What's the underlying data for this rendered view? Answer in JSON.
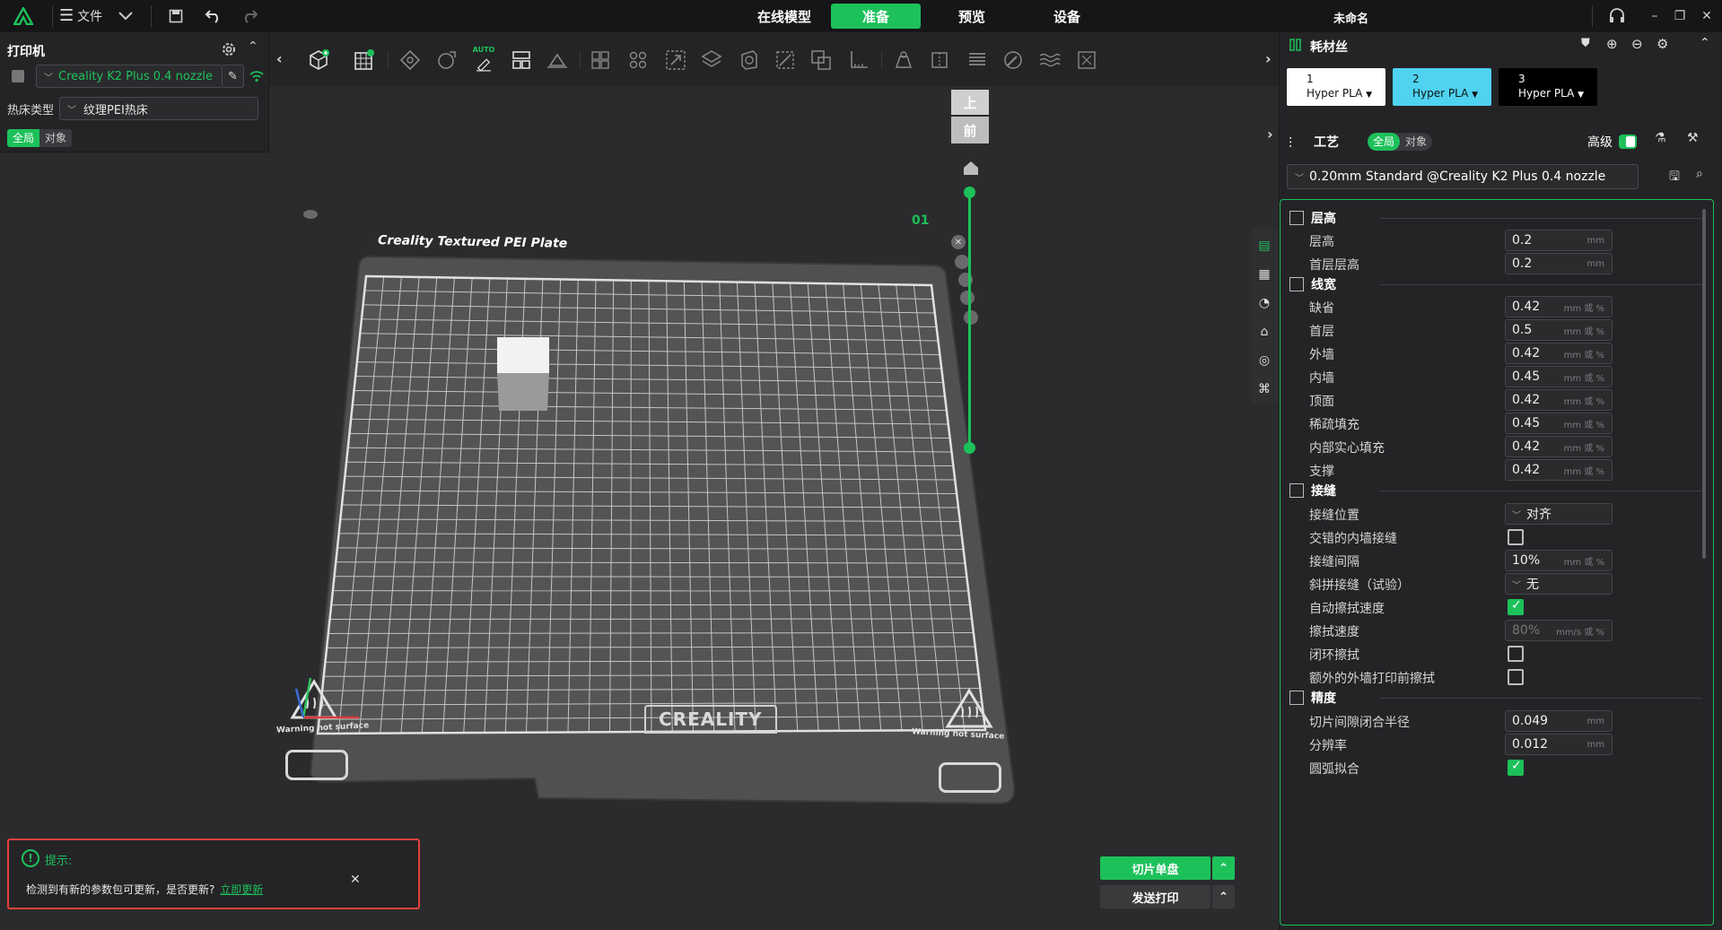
{
  "app": {
    "title": "未命名",
    "menu_file": "文件"
  },
  "tabs": [
    {
      "label": "在线模型",
      "active": false
    },
    {
      "label": "准备",
      "active": true
    },
    {
      "label": "预览",
      "active": false
    },
    {
      "label": "设备",
      "active": false
    }
  ],
  "left": {
    "printer_title": "打印机",
    "printer_name": "Creality K2 Plus 0.4 nozzle",
    "bed_label": "热床类型",
    "bed_value": "纹理PEI热床",
    "scope_global": "全局",
    "scope_object": "对象"
  },
  "plate": {
    "name": "Creality Textured PEI Plate",
    "index": "01",
    "brand": "CREALITY",
    "warning": "Warning hot surface"
  },
  "viewcube": {
    "top": "上",
    "front": "前"
  },
  "filament": {
    "title": "耗材丝",
    "slots": [
      {
        "num": "1",
        "name": "Hyper PLA",
        "color": "#ffffff",
        "text": "#111111"
      },
      {
        "num": "2",
        "name": "Hyper PLA",
        "color": "#4fd3f0",
        "text": "#111111"
      },
      {
        "num": "3",
        "name": "Hyper PLA",
        "color": "#000000",
        "text": "#ffffff"
      }
    ]
  },
  "process": {
    "title": "工艺",
    "scope_global": "全局",
    "scope_object": "对象",
    "advanced": "高级",
    "advanced_on": true,
    "preset": "0.20mm Standard @Creality K2 Plus 0.4 nozzle"
  },
  "sections": {
    "layer_height": "层高",
    "line_width": "线宽",
    "seam": "接缝",
    "precision": "精度"
  },
  "settings": {
    "layer_height": {
      "label": "层高",
      "value": "0.2",
      "unit": "mm"
    },
    "first_layer_height": {
      "label": "首层层高",
      "value": "0.2",
      "unit": "mm"
    },
    "default_width": {
      "label": "缺省",
      "value": "0.42",
      "unit": "mm 或 %"
    },
    "first_layer_width": {
      "label": "首层",
      "value": "0.5",
      "unit": "mm 或 %"
    },
    "outer_wall": {
      "label": "外墙",
      "value": "0.42",
      "unit": "mm 或 %"
    },
    "inner_wall": {
      "label": "内墙",
      "value": "0.45",
      "unit": "mm 或 %"
    },
    "top_surface": {
      "label": "顶面",
      "value": "0.42",
      "unit": "mm 或 %"
    },
    "sparse_infill": {
      "label": "稀疏填充",
      "value": "0.45",
      "unit": "mm 或 %"
    },
    "internal_solid": {
      "label": "内部实心填充",
      "value": "0.42",
      "unit": "mm 或 %"
    },
    "support": {
      "label": "支撑",
      "value": "0.42",
      "unit": "mm 或 %"
    },
    "seam_position": {
      "label": "接缝位置",
      "value": "对齐"
    },
    "staggered_seam": {
      "label": "交错的内墙接缝",
      "checked": false
    },
    "seam_gap": {
      "label": "接缝间隔",
      "value": "10%",
      "unit": "mm 或 %"
    },
    "scarf_seam": {
      "label": "斜拼接缝（试验）",
      "value": "无"
    },
    "auto_wipe_speed": {
      "label": "自动擦拭速度",
      "checked": true
    },
    "wipe_speed": {
      "label": "擦拭速度",
      "value": "80%",
      "unit": "mm/s 或 %"
    },
    "loop_wipe": {
      "label": "闭环擦拭",
      "checked": false
    },
    "extra_wipe": {
      "label": "额外的外墙打印前擦拭",
      "checked": false
    },
    "slice_gap": {
      "label": "切片间隙闭合半径",
      "value": "0.049",
      "unit": "mm"
    },
    "resolution": {
      "label": "分辨率",
      "value": "0.012",
      "unit": "mm"
    },
    "arc_fitting": {
      "label": "圆弧拟合",
      "checked": true
    }
  },
  "actions": {
    "slice": "切片单盘",
    "send": "发送打印"
  },
  "toast": {
    "title": "提示:",
    "message": "检测到有新的参数包可更新，是否更新?",
    "link": "立即更新"
  },
  "colors": {
    "accent": "#1dc15a",
    "toast_border": "#e5413a"
  }
}
